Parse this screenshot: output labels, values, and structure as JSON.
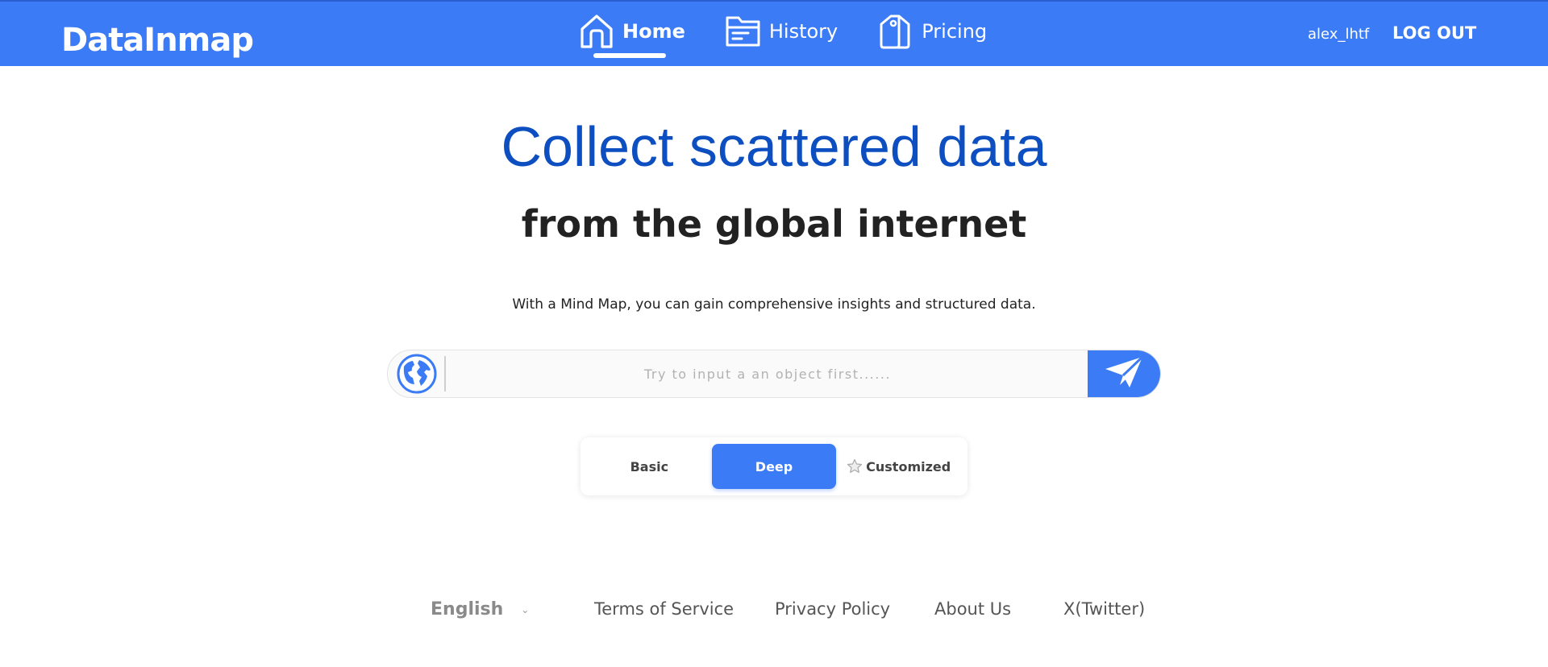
{
  "header": {
    "logo_text": "DataInmap",
    "nav": [
      {
        "label": "Home",
        "icon": "home-icon",
        "active": true
      },
      {
        "label": "History",
        "icon": "folder-icon",
        "active": false
      },
      {
        "label": "Pricing",
        "icon": "price-tag-icon",
        "active": false
      }
    ],
    "username": "alex_lhtf",
    "logout_label": "LOG OUT"
  },
  "hero": {
    "title": "Collect scattered data",
    "subtitle": "from the global internet",
    "description": "With a Mind Map, you can gain comprehensive insights and structured data."
  },
  "search": {
    "placeholder": "Try to input a an object first......",
    "value": "",
    "left_icon": "globe-icon",
    "submit_icon": "paper-plane-icon"
  },
  "modes": {
    "basic": "Basic",
    "deep": "Deep",
    "customized": "Customized",
    "selected": "Deep"
  },
  "footer": {
    "language": "English",
    "links": {
      "terms": "Terms of Service",
      "privacy": "Privacy Policy",
      "about": "About Us",
      "twitter": "X(Twitter)"
    }
  },
  "colors": {
    "brand": "#3c7bf6",
    "title": "#0d4fc0"
  }
}
